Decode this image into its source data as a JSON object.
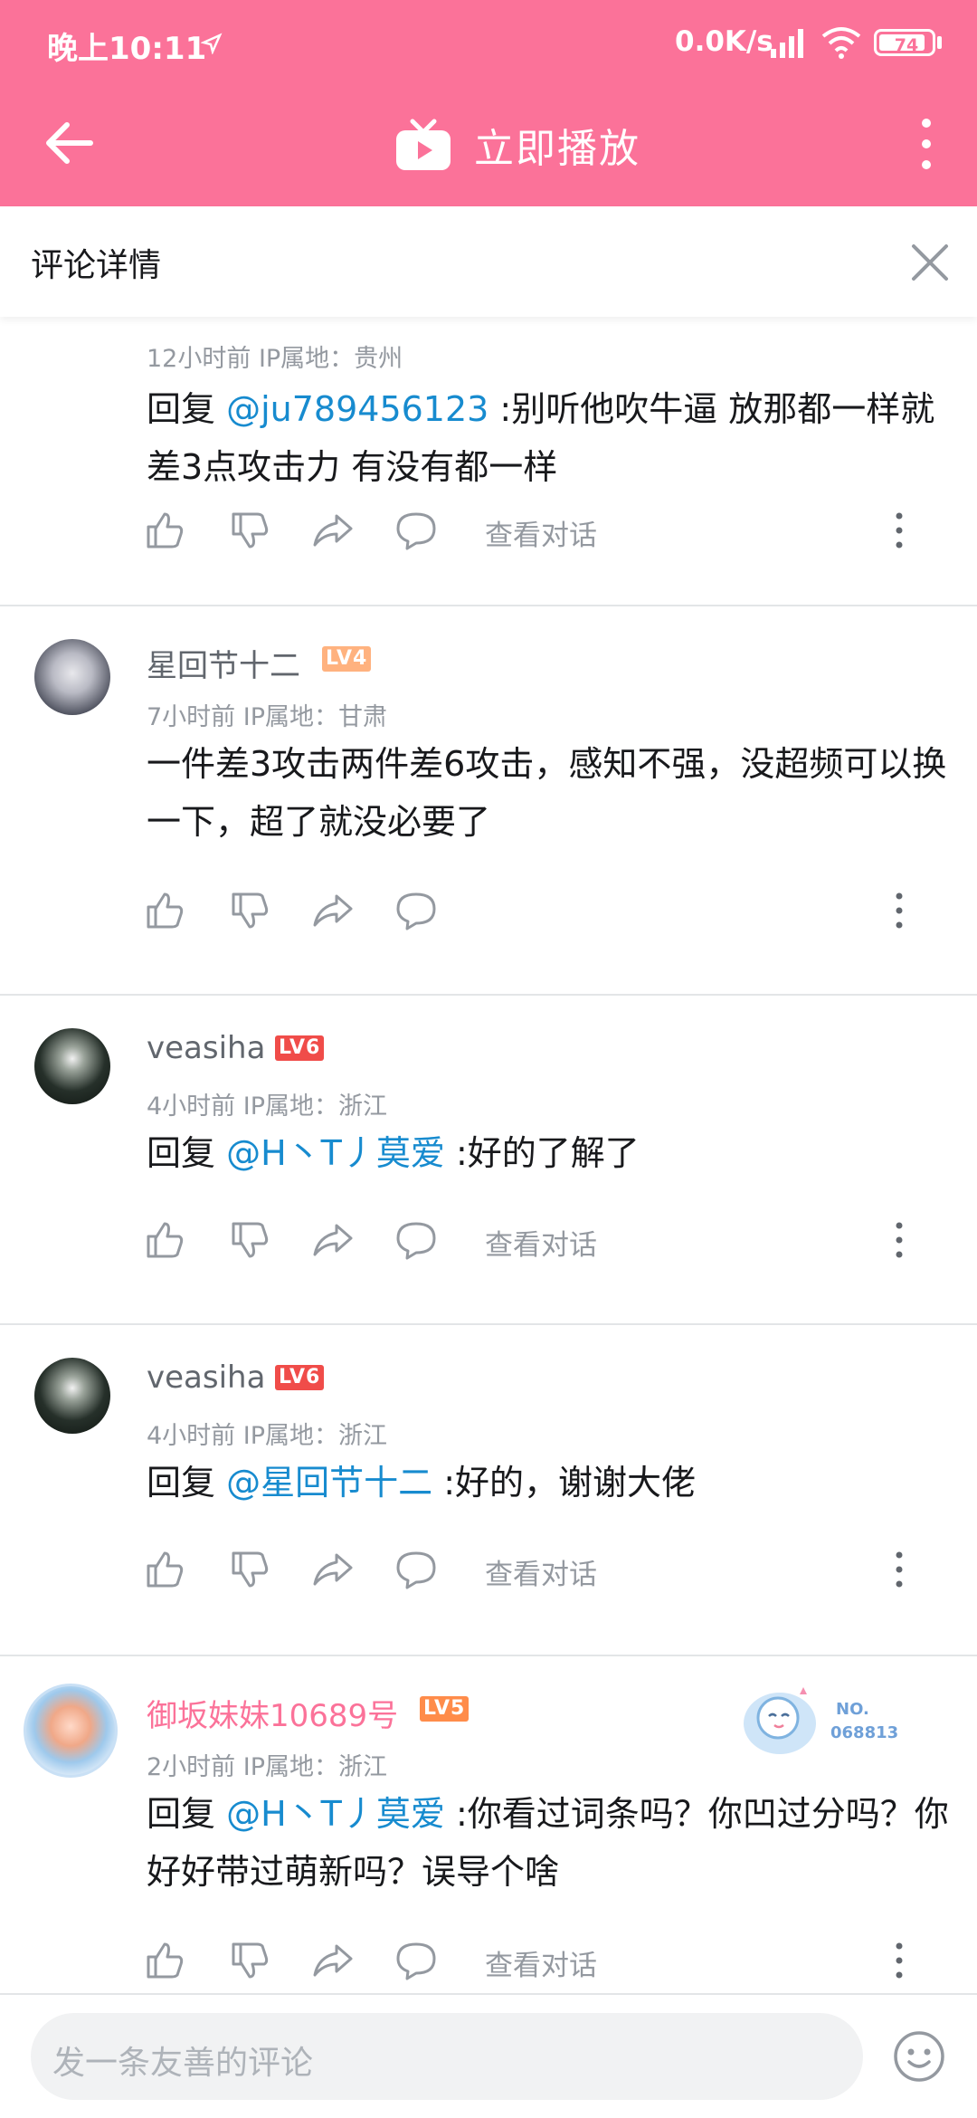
{
  "status_bar": {
    "time": "晚上10:11",
    "network_speed": "0.0K/s",
    "battery": "74"
  },
  "header": {
    "title": "立即播放",
    "back_icon": "arrow-left-icon",
    "tv_icon": "tv-play-icon",
    "more_icon": "more-vertical-icon"
  },
  "panel": {
    "title": "评论详情",
    "close_icon": "close-icon"
  },
  "comments": [
    {
      "username": "",
      "level": "",
      "meta": "12小时前  IP属地：贵州",
      "prefix": "回复 ",
      "mention": "@ju789456123",
      "text": " :别听他吹牛逼  放那都一样就差3点攻击力  有没有都一样",
      "view_conversation": "查看对话"
    },
    {
      "username": "星回节十二",
      "level": "LV4",
      "meta": "7小时前  IP属地：甘肃",
      "prefix": "",
      "mention": "",
      "text": "一件差3攻击两件差6攻击，感知不强，没超频可以换一下，超了就没必要了",
      "view_conversation": ""
    },
    {
      "username": "veasiha",
      "level": "LV6",
      "meta": "4小时前  IP属地：浙江",
      "prefix": "回复 ",
      "mention": "@H丶T丿莫爱",
      "text": " :好的了解了",
      "view_conversation": "查看对话"
    },
    {
      "username": "veasiha",
      "level": "LV6",
      "meta": "4小时前  IP属地：浙江",
      "prefix": "回复 ",
      "mention": "@星回节十二",
      "text": " :好的，谢谢大佬",
      "view_conversation": "查看对话"
    },
    {
      "username": "御坂妹妹10689号",
      "level": "LV5",
      "meta": "2小时前  IP属地：浙江",
      "prefix": "回复 ",
      "mention": "@H丶T丿莫爱",
      "text": " :你看过词条吗？你凹过分吗？你好好带过萌新吗？误导个啥",
      "view_conversation": "查看对话",
      "fan_badge": {
        "line1": "NO.",
        "line2": "068813"
      }
    }
  ],
  "bottom_bar": {
    "placeholder": "发一条友善的评论",
    "emoji_icon": "emoji-icon"
  },
  "colors": {
    "brand": "#fb7299",
    "mention": "#178bcf",
    "muted": "#9499a0"
  }
}
